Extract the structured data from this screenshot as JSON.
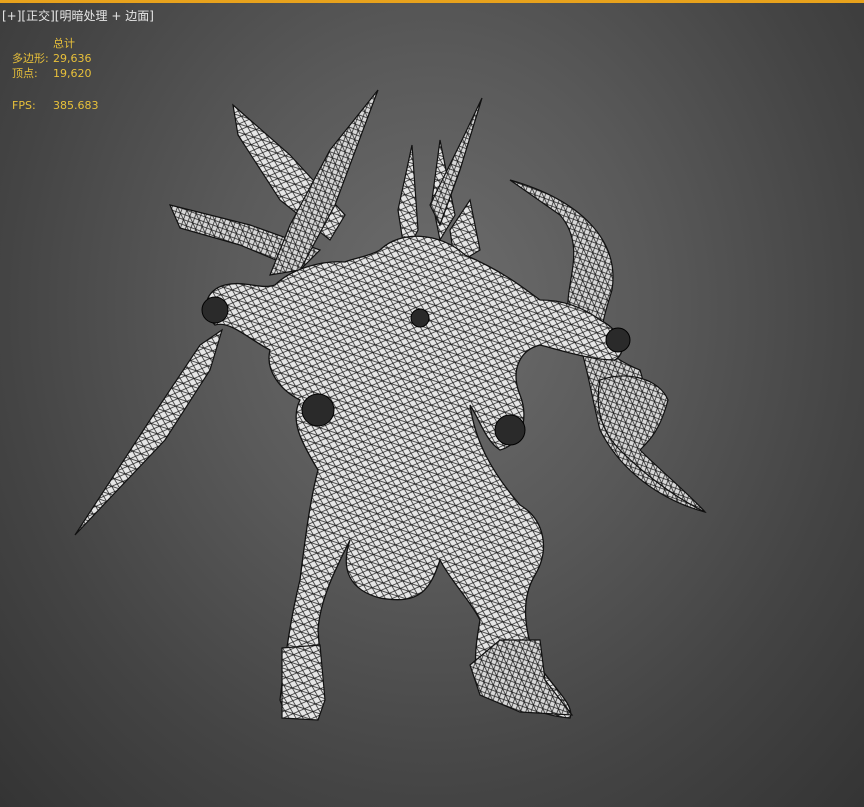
{
  "viewport": {
    "label_plus": "[+]",
    "label_view": "[正交]",
    "label_shading_prefix": "[",
    "label_shading": "明暗处理",
    "label_plus_sep": " + ",
    "label_edges": "边面",
    "label_shading_suffix": "]",
    "border_color": "#e8a21c"
  },
  "stats": {
    "header": "总计",
    "polys_label": "多边形:",
    "polys_value": "29,636",
    "verts_label": "顶点:",
    "verts_value": "19,620",
    "fps_label": "FPS:",
    "fps_value": "385.683",
    "text_color": "#e8c03a"
  },
  "scene": {
    "object": "wireframe-mech-model",
    "wire_color": "#111111",
    "surface_color": "#dcdcdc"
  }
}
